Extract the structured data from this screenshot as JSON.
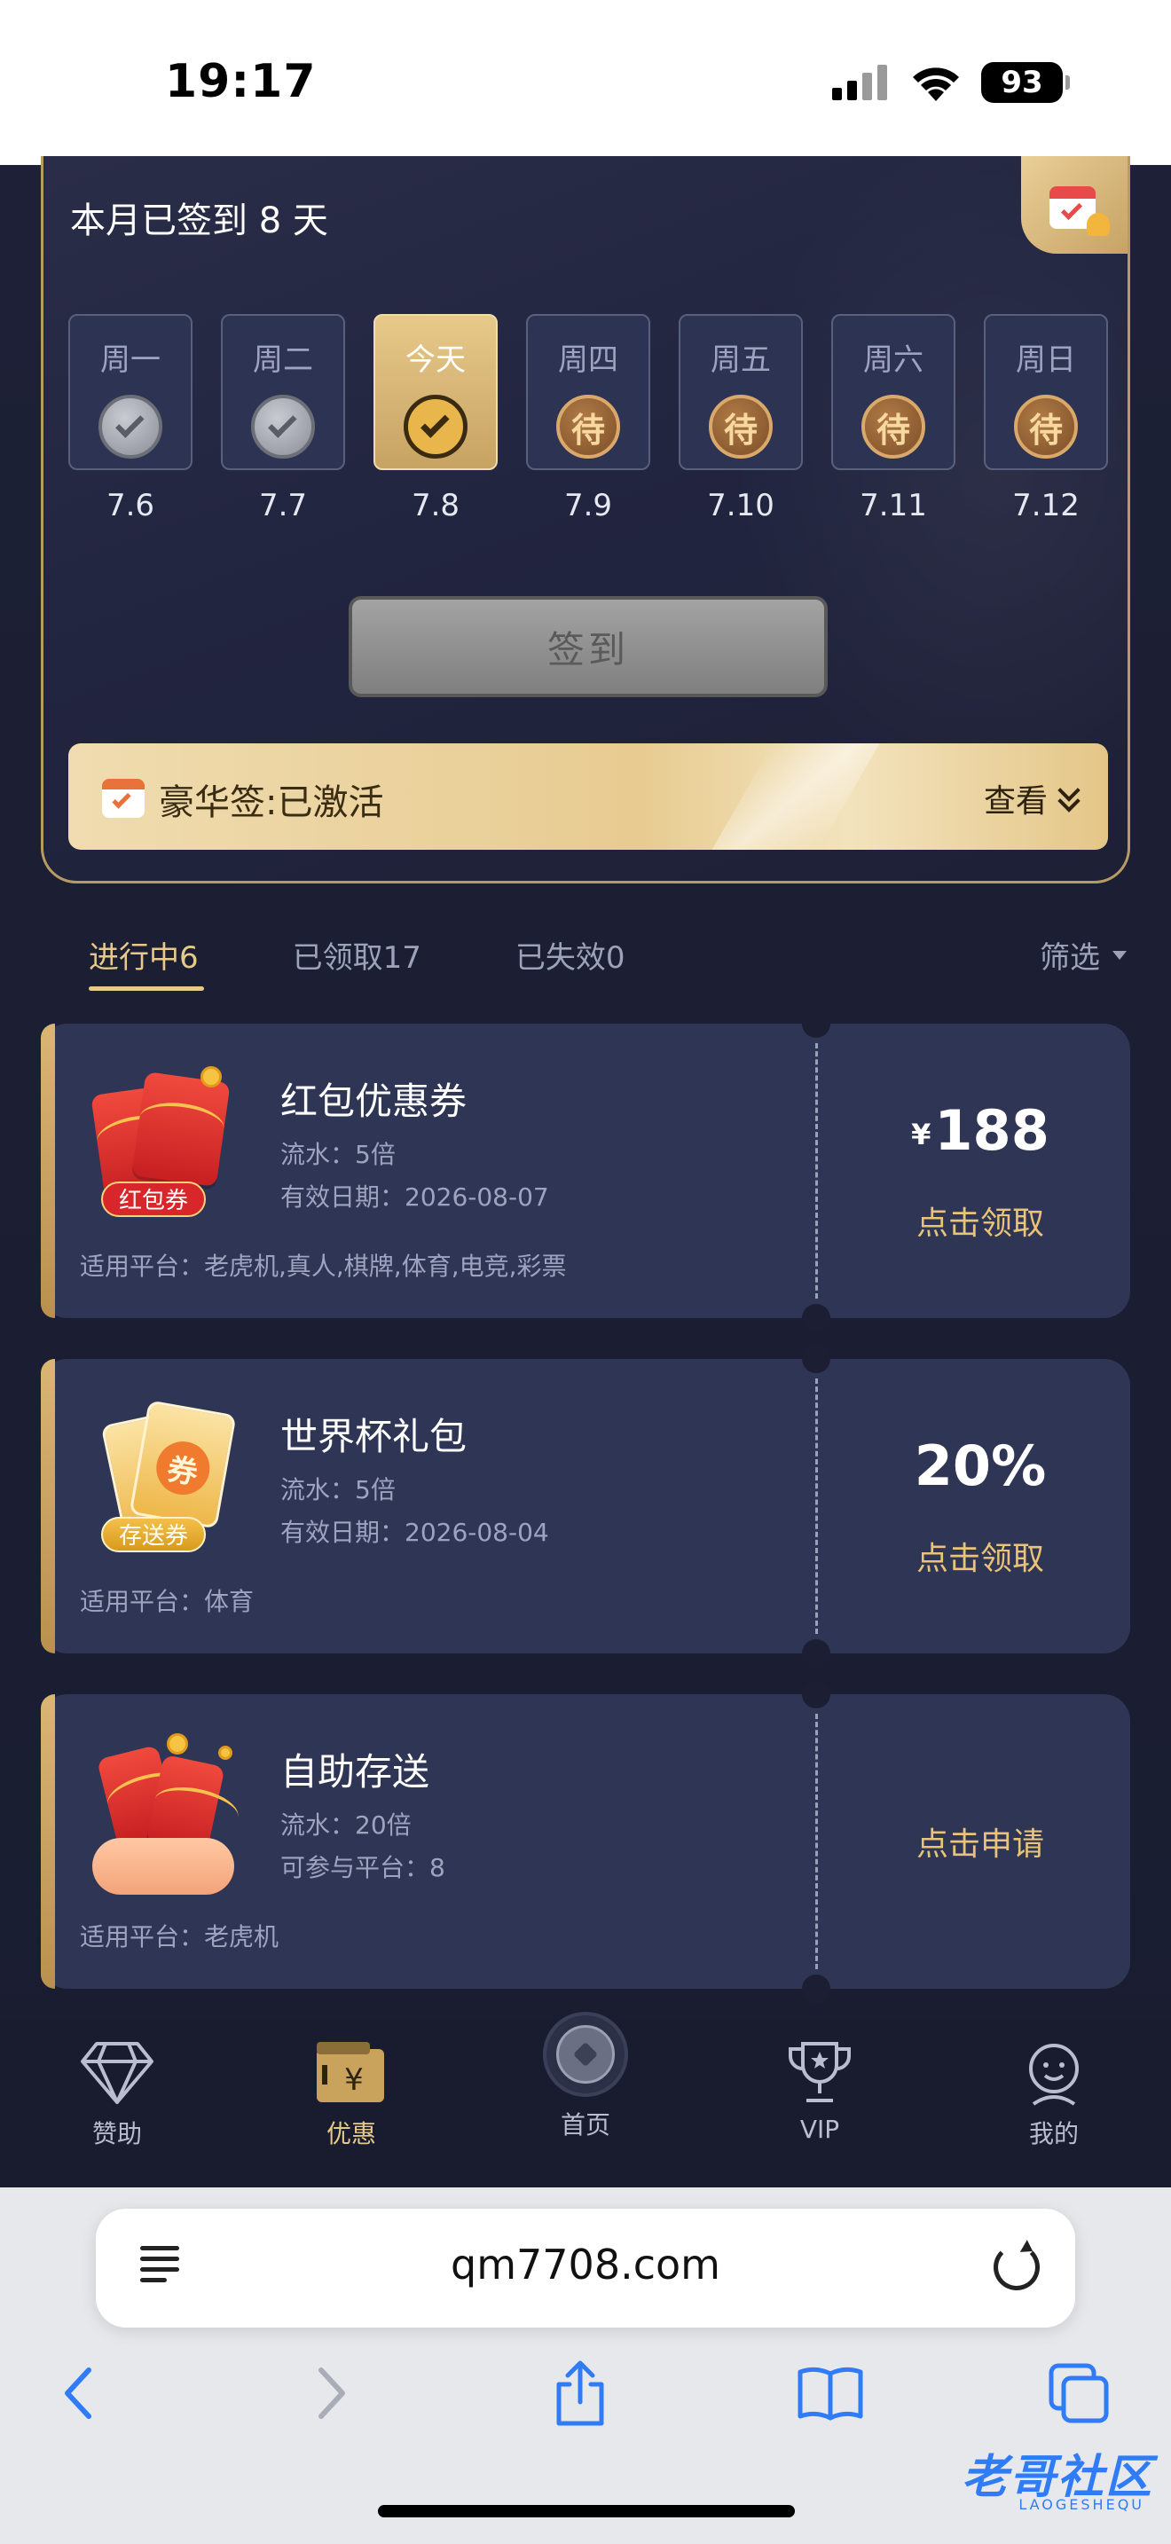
{
  "status": {
    "time": "19:17",
    "battery": "93"
  },
  "sign": {
    "title": "本月已签到 8 天",
    "days": [
      {
        "label": "周一",
        "date": "7.6",
        "state": "done"
      },
      {
        "label": "周二",
        "date": "7.7",
        "state": "done"
      },
      {
        "label": "今天",
        "date": "7.8",
        "state": "today"
      },
      {
        "label": "周四",
        "date": "7.9",
        "state": "pending",
        "mark": "待"
      },
      {
        "label": "周五",
        "date": "7.10",
        "state": "pending",
        "mark": "待"
      },
      {
        "label": "周六",
        "date": "7.11",
        "state": "pending",
        "mark": "待"
      },
      {
        "label": "周日",
        "date": "7.12",
        "state": "pending",
        "mark": "待"
      }
    ],
    "button": "签到",
    "deluxe": {
      "text": "豪华签:已激活",
      "view": "查看"
    }
  },
  "tabs": [
    {
      "label": "进行中6",
      "active": true
    },
    {
      "label": "已领取17",
      "active": false
    },
    {
      "label": "已失效0",
      "active": false
    }
  ],
  "filter": "筛选",
  "coupons": [
    {
      "name": "红包优惠券",
      "line1": "流水：5倍",
      "line2": "有效日期：2026-08-07",
      "platform": "适用平台：老虎机,真人,棋牌,体育,电竞,彩票",
      "currency": "¥",
      "value": "188",
      "action": "点击领取",
      "tag": "红包券"
    },
    {
      "name": "世界杯礼包",
      "line1": "流水：5倍",
      "line2": "有效日期：2026-08-04",
      "platform": "适用平台：体育",
      "currency": "",
      "value": "20%",
      "action": "点击领取",
      "tag": "存送券",
      "ticket_mark": "券"
    },
    {
      "name": "自助存送",
      "line1": "流水：20倍",
      "line2": "可参与平台：8",
      "platform": "适用平台：老虎机",
      "currency": "",
      "value": "",
      "action": "点击申请"
    }
  ],
  "nav": [
    {
      "label": "赞助",
      "icon": "diamond-icon"
    },
    {
      "label": "优惠",
      "icon": "wallet-yen-icon",
      "active": true
    },
    {
      "label": "首页",
      "icon": "soccer-ball-icon"
    },
    {
      "label": "VIP",
      "icon": "trophy-icon"
    },
    {
      "label": "我的",
      "icon": "user-face-icon"
    }
  ],
  "browser": {
    "url": "qm7708.com"
  },
  "watermark": {
    "main": "老哥社区",
    "sub": "LAOGESHEQU"
  },
  "colors": {
    "accent_gold": "#e7c98a",
    "action_gold": "#e8c378",
    "card_bg": "#2f3554",
    "page_bg": "#1b1e33",
    "ios_blue": "#2f7cf6"
  }
}
